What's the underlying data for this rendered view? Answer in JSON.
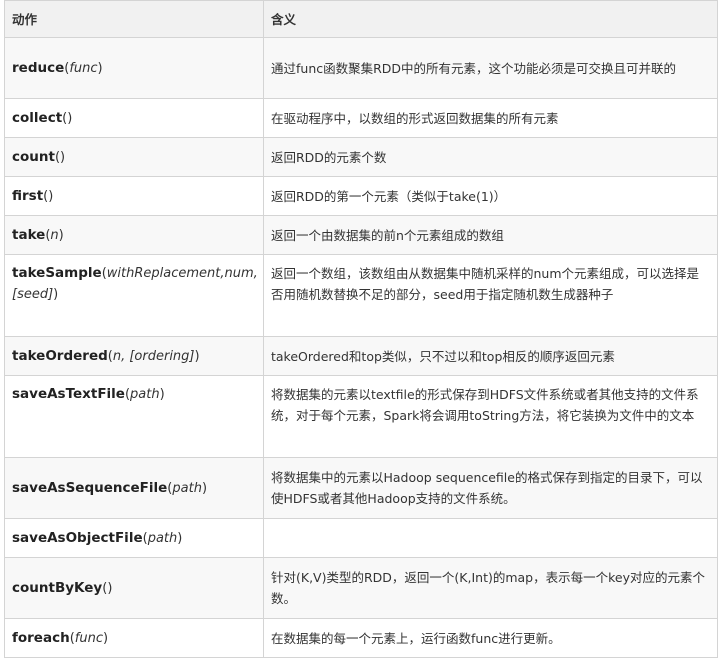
{
  "table": {
    "headers": [
      "动作",
      "含义"
    ],
    "rows": [
      {
        "fn": "reduce",
        "args": "func",
        "desc": "通过func函数聚集RDD中的所有元素，这个功能必须是可交换且可并联的"
      },
      {
        "fn": "collect",
        "args": "",
        "desc": "在驱动程序中，以数组的形式返回数据集的所有元素"
      },
      {
        "fn": "count",
        "args": "",
        "desc": "返回RDD的元素个数"
      },
      {
        "fn": "first",
        "args": "",
        "desc": "返回RDD的第一个元素（类似于take(1)）"
      },
      {
        "fn": "take",
        "args": "n",
        "desc": "返回一个由数据集的前n个元素组成的数组"
      },
      {
        "fn": "takeSample",
        "args": "withReplacement,num, [seed]",
        "desc": "返回一个数组，该数组由从数据集中随机采样的num个元素组成，可以选择是否用随机数替换不足的部分，seed用于指定随机数生成器种子"
      },
      {
        "fn": "takeOrdered",
        "args": "n, [ordering]",
        "desc": "takeOrdered和top类似，只不过以和top相反的顺序返回元素"
      },
      {
        "fn": "saveAsTextFile",
        "args": "path",
        "desc": "将数据集的元素以textfile的形式保存到HDFS文件系统或者其他支持的文件系统，对于每个元素，Spark将会调用toString方法，将它装换为文件中的文本"
      },
      {
        "fn": "saveAsSequenceFile",
        "args": "path",
        "desc": "将数据集中的元素以Hadoop sequencefile的格式保存到指定的目录下，可以使HDFS或者其他Hadoop支持的文件系统。"
      },
      {
        "fn": "saveAsObjectFile",
        "args": "path",
        "desc": ""
      },
      {
        "fn": "countByKey",
        "args": "",
        "desc": "针对(K,V)类型的RDD，返回一个(K,Int)的map，表示每一个key对应的元素个数。"
      },
      {
        "fn": "foreach",
        "args": "func",
        "desc": "在数据集的每一个元素上，运行函数func进行更新。"
      }
    ]
  }
}
